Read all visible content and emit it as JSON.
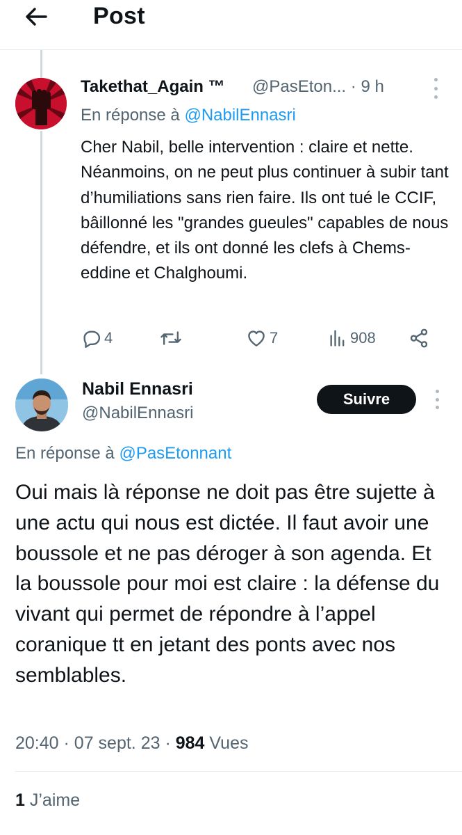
{
  "header": {
    "title": "Post",
    "back_icon": "arrow-left-icon"
  },
  "reply_tweet": {
    "display_name": "Takethat_Again ™",
    "handle": "@PasEton...",
    "separator": "·",
    "time": "9 h",
    "in_reply_prefix": "En réponse à",
    "in_reply_handle": "@NabilEnnasri",
    "text": "Cher Nabil, belle intervention : claire et nette. Néanmoins, on ne peut plus continuer à subir tant d’humiliations sans rien faire. Ils ont tué le CCIF, bâillonné les \"grandes gueules\" capables de nous défendre, et ils ont donné les clefs à Chems-eddine et Chalghoumi.",
    "replies": "4",
    "retweets": "",
    "likes": "7",
    "views": "908"
  },
  "main_tweet": {
    "display_name": "Nabil Ennasri",
    "handle": "@NabilEnnasri",
    "follow_label": "Suivre",
    "in_reply_prefix": "En réponse à",
    "in_reply_handle": "@PasEtonnant",
    "text": "Oui mais là réponse ne doit pas être sujette à une actu qui nous est dictée. Il faut avoir une boussole et ne pas déroger à son agenda. Et la boussole pour moi est claire : la défense du vivant qui permet de répondre à l’appel coranique tt en jetant des ponts avec nos semblables.",
    "time": "20:40",
    "date": "07 sept. 23",
    "views_count": "984",
    "views_label": "Vues",
    "likes_count": "1",
    "likes_label": "J’aime"
  },
  "colors": {
    "accent": "#1d9bf0",
    "text": "#0f1419",
    "secondary": "#536471",
    "avatar1_bg": "#c8102e"
  }
}
